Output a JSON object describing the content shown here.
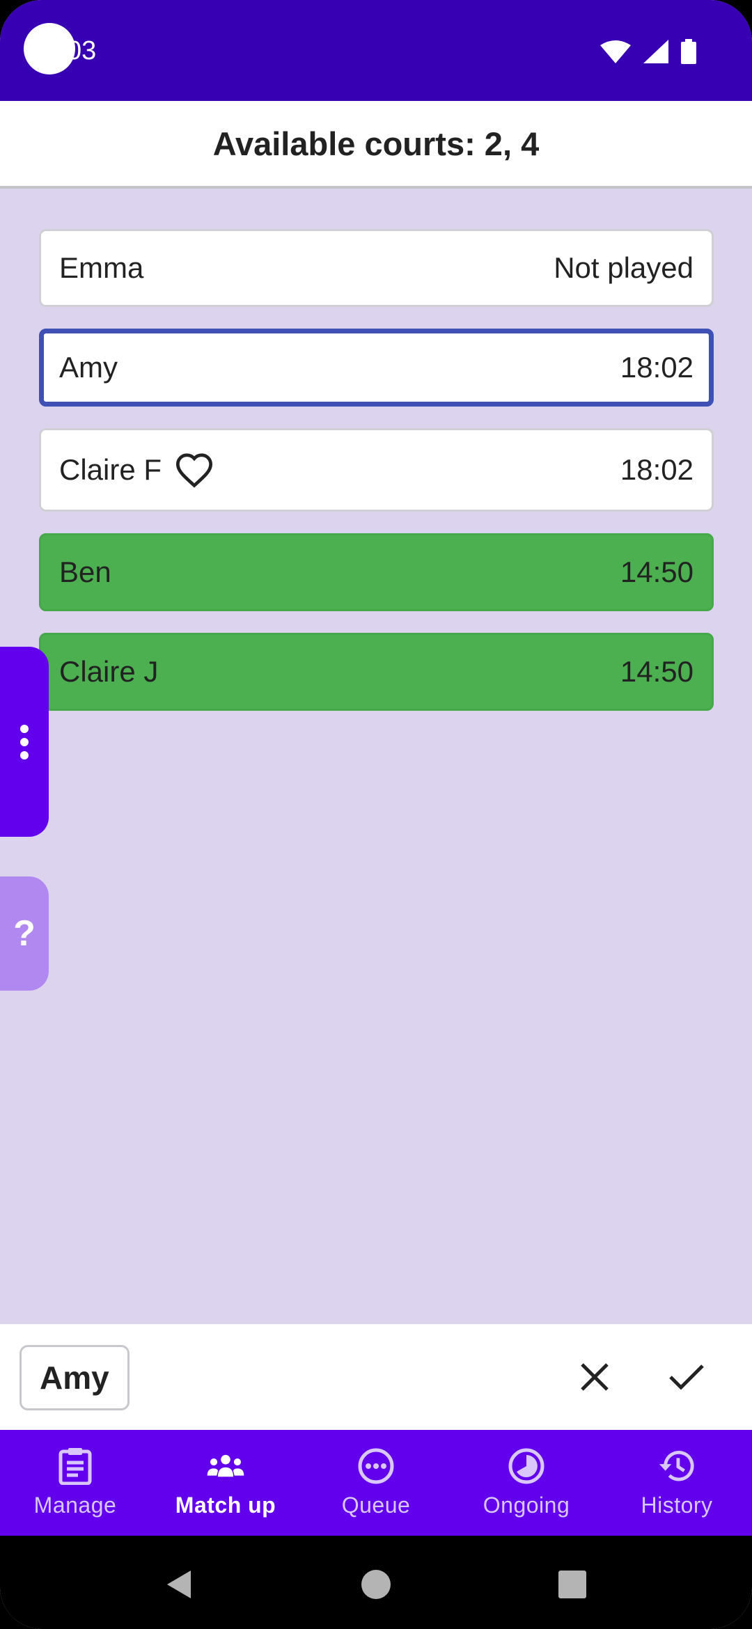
{
  "status_bar": {
    "time": "03"
  },
  "header": {
    "title": "Available courts: 2, 4"
  },
  "players": [
    {
      "name": "Emma",
      "time": "Not played",
      "state": "default",
      "favorite": false
    },
    {
      "name": "Amy",
      "time": "18:02",
      "state": "selected",
      "favorite": false
    },
    {
      "name": "Claire F",
      "time": "18:02",
      "state": "default",
      "favorite": true
    },
    {
      "name": "Ben",
      "time": "14:50",
      "state": "playing",
      "favorite": false
    },
    {
      "name": "Claire J",
      "time": "14:50",
      "state": "playing",
      "favorite": false
    }
  ],
  "side_tabs": {
    "help_label": "?"
  },
  "selection": {
    "chip_label": "Amy"
  },
  "bottom_nav": {
    "items": [
      {
        "label": "Manage",
        "icon": "clipboard-icon"
      },
      {
        "label": "Match up",
        "icon": "people-icon",
        "active": true
      },
      {
        "label": "Queue",
        "icon": "more-circle-icon"
      },
      {
        "label": "Ongoing",
        "icon": "pie-timer-icon"
      },
      {
        "label": "History",
        "icon": "history-icon"
      }
    ]
  },
  "colors": {
    "status_bar": "#3700b3",
    "primary": "#6200ee",
    "background": "#dcd4ee",
    "selected_border": "#3f51b5",
    "playing": "#4caf50"
  }
}
